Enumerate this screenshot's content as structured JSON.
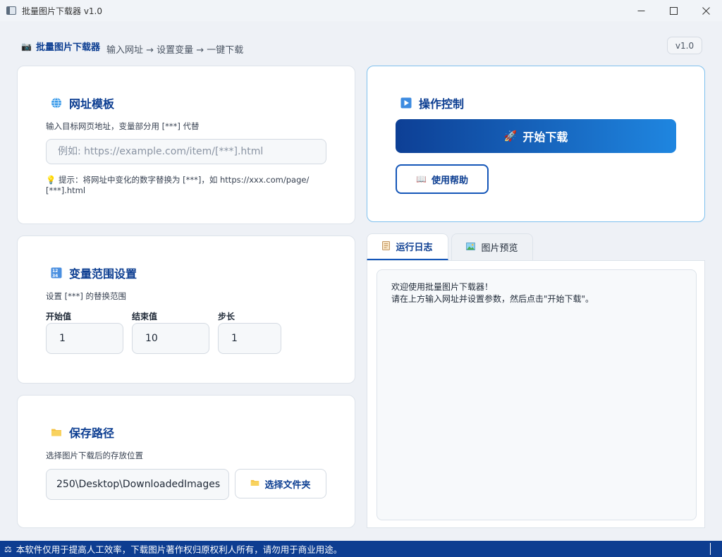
{
  "window": {
    "title": "批量图片下载器 v1.0"
  },
  "header": {
    "app_name": "批量图片下载器",
    "flow": "输入网址 → 设置变量 → 一键下载",
    "version": "v1.0"
  },
  "url_card": {
    "title": "网址模板",
    "description": "输入目标网页地址，变量部分用 [***] 代替",
    "input_value": "",
    "input_placeholder": "例如: https://example.com/item/[***].html",
    "tip_line1": "💡 提示：将网址中变化的数字替换为 [***]，如 https://xxx.com/page/",
    "tip_line2": "[***].html"
  },
  "range_card": {
    "title": "变量范围设置",
    "description": "设置 [***] 的替换范围",
    "start_label": "开始值",
    "start_value": "1",
    "end_label": "结束值",
    "end_value": "10",
    "step_label": "步长",
    "step_value": "1"
  },
  "save_card": {
    "title": "保存路径",
    "description": "选择图片下载后的存放位置",
    "path_value": "250\\Desktop\\DownloadedImages",
    "choose_folder_label": "选择文件夹"
  },
  "control_card": {
    "title": "操作控制",
    "start_button_label": "开始下载",
    "help_button_label": "使用帮助"
  },
  "tabs": {
    "log_label": "运行日志",
    "preview_label": "图片预览"
  },
  "log": {
    "line1": "欢迎使用批量图片下载器！",
    "line2": "请在上方输入网址并设置参数，然后点击\"开始下载\"。"
  },
  "statusbar": {
    "text": "本软件仅用于提高人工效率，下载图片著作权归原权利人所有，请勿用于商业用途。"
  },
  "icons": {
    "camera": "camera-icon",
    "globe": "globe-icon",
    "numbers": "numbers-icon",
    "folder": "folder-icon",
    "play": "play-icon",
    "rocket": "rocket-icon",
    "book": "book-icon",
    "log": "log-icon",
    "image": "image-icon",
    "scale": "scale-icon"
  },
  "colors": {
    "accent": "#0b3d91",
    "accent_light": "#1f86e0",
    "statusbar": "#0d3d91"
  }
}
